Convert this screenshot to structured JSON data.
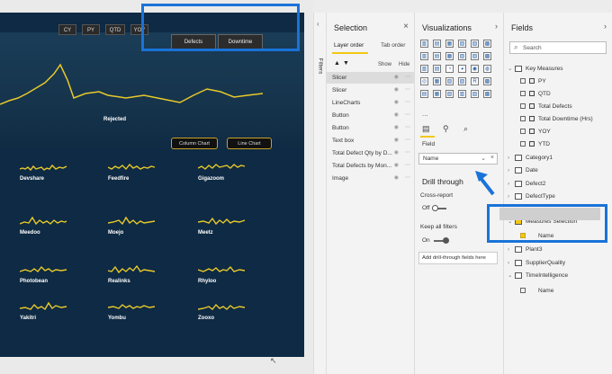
{
  "report": {
    "top_buttons": [
      "CY",
      "PY",
      "QTD",
      "YOY"
    ],
    "toggle": [
      "Defects",
      "Downtime"
    ],
    "rejected_label": "Rejected",
    "chart_buttons": [
      "Column Chart",
      "Line Chart"
    ],
    "sparklines": [
      [
        "Devshare",
        "Feedfire",
        "Gigazoom"
      ],
      [
        "Meedoo",
        "Moejo",
        "Meetz"
      ],
      [
        "Photobean",
        "Realinks",
        "Rhyloo"
      ],
      [
        "Yakitri",
        "Yombu",
        "Zooxo"
      ]
    ]
  },
  "filters_tab": "Filters",
  "selection": {
    "title": "Selection",
    "tabs": [
      "Layer order",
      "Tab order"
    ],
    "show": "Show",
    "hide": "Hide",
    "layers": [
      "Slicer",
      "Slicer",
      "LineCharts",
      "Button",
      "Button",
      "Text box",
      "Total Defect Qty by D...",
      "Total Defects by Mon...",
      "Image"
    ]
  },
  "visualizations": {
    "title": "Visualizations",
    "field_label": "Field",
    "field_value": "Name",
    "drill_through": "Drill through",
    "cross_report": "Cross-report",
    "cross_report_state": "Off",
    "keep_filters": "Keep all filters",
    "keep_filters_state": "On",
    "add_fields": "Add drill-through fields here",
    "more": "..."
  },
  "fields": {
    "title": "Fields",
    "search_placeholder": "Search",
    "items": [
      {
        "label": "Key Measures",
        "type": "table",
        "expanded": true
      },
      {
        "label": "PY",
        "type": "measure"
      },
      {
        "label": "QTD",
        "type": "measure"
      },
      {
        "label": "Total Defects",
        "type": "measure"
      },
      {
        "label": "Total Downtime (Hrs)",
        "type": "measure"
      },
      {
        "label": "YOY",
        "type": "measure"
      },
      {
        "label": "YTD",
        "type": "measure"
      },
      {
        "label": "Category1",
        "type": "table"
      },
      {
        "label": "Date",
        "type": "table"
      },
      {
        "label": "Defect2",
        "type": "table"
      },
      {
        "label": "DefectType",
        "type": "table"
      },
      {
        "label": "Measures Selection",
        "type": "table-selected",
        "expanded": true
      },
      {
        "label": "Name",
        "type": "field-checked"
      },
      {
        "label": "Plant3",
        "type": "table"
      },
      {
        "label": "SupplierQuality",
        "type": "table"
      },
      {
        "label": "TimeIntelligence",
        "type": "table",
        "expanded": true
      },
      {
        "label": "Name",
        "type": "field"
      }
    ]
  },
  "colors": {
    "accent": "#f2c811",
    "highlight": "#1a73d8",
    "report_bg": "#0e2a44"
  }
}
